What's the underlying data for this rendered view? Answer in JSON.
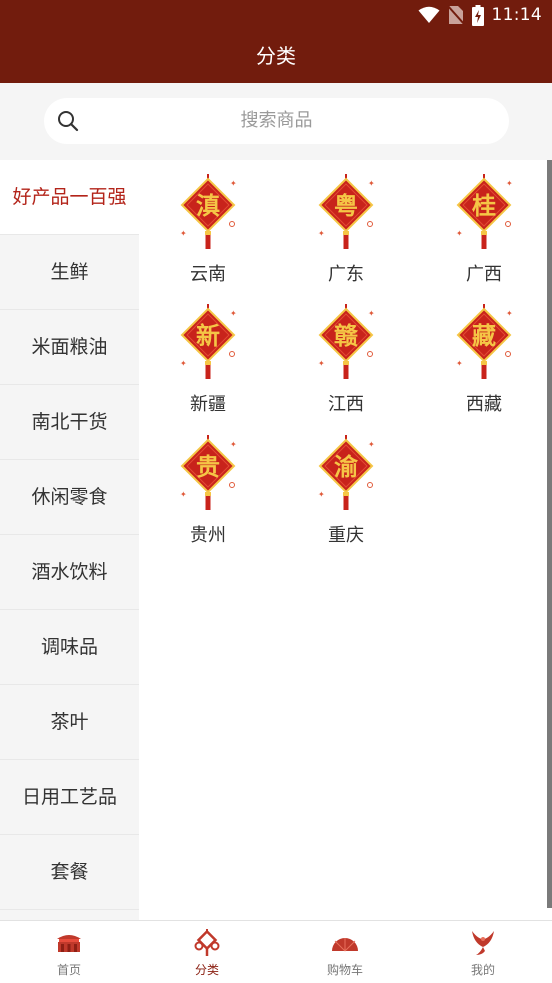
{
  "status_bar": {
    "time": "11:14"
  },
  "header": {
    "title": "分类"
  },
  "search": {
    "placeholder": "搜索商品"
  },
  "sidebar": {
    "items": [
      {
        "label": "好产品一百强",
        "active": true
      },
      {
        "label": "生鲜"
      },
      {
        "label": "米面粮油"
      },
      {
        "label": "南北干货"
      },
      {
        "label": "休闲零食"
      },
      {
        "label": "酒水饮料"
      },
      {
        "label": "调味品"
      },
      {
        "label": "茶叶"
      },
      {
        "label": "日用工艺品"
      },
      {
        "label": "套餐"
      }
    ]
  },
  "regions": [
    {
      "label": "云南",
      "glyph": "滇"
    },
    {
      "label": "广东",
      "glyph": "粤"
    },
    {
      "label": "广西",
      "glyph": "桂"
    },
    {
      "label": "新疆",
      "glyph": "新"
    },
    {
      "label": "江西",
      "glyph": "赣"
    },
    {
      "label": "西藏",
      "glyph": "藏"
    },
    {
      "label": "贵州",
      "glyph": "贵"
    },
    {
      "label": "重庆",
      "glyph": "渝"
    }
  ],
  "bottom_nav": [
    {
      "label": "首页",
      "icon": "home-temple-icon"
    },
    {
      "label": "分类",
      "icon": "category-knot-icon",
      "active": true
    },
    {
      "label": "购物车",
      "icon": "cart-fan-icon"
    },
    {
      "label": "我的",
      "icon": "profile-phoenix-icon"
    }
  ],
  "colors": {
    "brand": "#721c0d",
    "accent_red": "#b3241a",
    "knot_red": "#c8231b",
    "gold": "#f5c646"
  }
}
